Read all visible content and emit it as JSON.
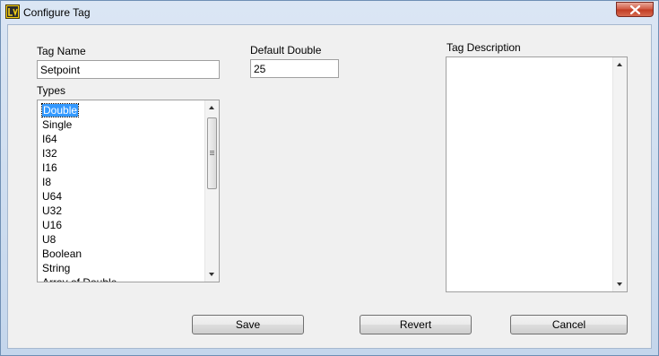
{
  "window": {
    "title": "Configure Tag"
  },
  "form": {
    "tag_name_label": "Tag Name",
    "tag_name_value": "Setpoint",
    "default_double_label": "Default Double",
    "default_double_value": "25",
    "types_label": "Types",
    "tag_description_label": "Tag Description",
    "tag_description_value": ""
  },
  "types": {
    "selected": "Double",
    "items": [
      "Double",
      "Single",
      "I64",
      "I32",
      "I16",
      "I8",
      "U64",
      "U32",
      "U16",
      "U8",
      "Boolean",
      "String",
      "Array of Double"
    ]
  },
  "buttons": {
    "save": "Save",
    "revert": "Revert",
    "cancel": "Cancel"
  },
  "colors": {
    "selection": "#3399ff",
    "close_button": "#c94a32"
  }
}
